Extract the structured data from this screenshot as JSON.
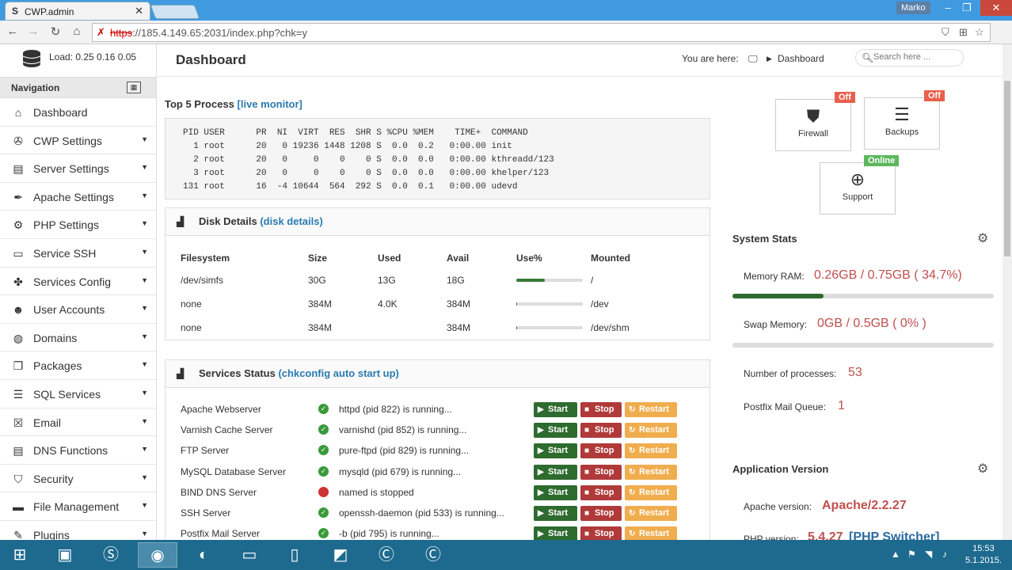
{
  "browser": {
    "tab_title": "CWP.admin",
    "tab_favicon": "S",
    "user_name": "Marko",
    "url_scheme": "https",
    "url_rest": "://185.4.149.65:2031/index.php?chk=y"
  },
  "sidebar": {
    "load_label": "Load: 0.25  0.16  0.05",
    "nav_title": "Navigation",
    "items": [
      {
        "label": "Dashboard",
        "icon": "home-icon",
        "glyph": "⌂",
        "caret": false
      },
      {
        "label": "CWP Settings",
        "icon": "wrench-icon",
        "glyph": "✇",
        "caret": true
      },
      {
        "label": "Server Settings",
        "icon": "server-icon",
        "glyph": "▤",
        "caret": true
      },
      {
        "label": "Apache Settings",
        "icon": "feather-icon",
        "glyph": "✒",
        "caret": true
      },
      {
        "label": "PHP Settings",
        "icon": "gear-icon",
        "glyph": "⚙",
        "caret": true
      },
      {
        "label": "Service SSH",
        "icon": "monitor-icon",
        "glyph": "▭",
        "caret": true
      },
      {
        "label": "Services Config",
        "icon": "puzzle-icon",
        "glyph": "✤",
        "caret": true
      },
      {
        "label": "User Accounts",
        "icon": "user-icon",
        "glyph": "☻",
        "caret": true
      },
      {
        "label": "Domains",
        "icon": "globe-icon",
        "glyph": "◍",
        "caret": true
      },
      {
        "label": "Packages",
        "icon": "package-icon",
        "glyph": "❒",
        "caret": true
      },
      {
        "label": "SQL Services",
        "icon": "database-icon",
        "glyph": "☰",
        "caret": true
      },
      {
        "label": "Email",
        "icon": "email-icon",
        "glyph": "☒",
        "caret": true
      },
      {
        "label": "DNS Functions",
        "icon": "dns-icon",
        "glyph": "▤",
        "caret": true
      },
      {
        "label": "Security",
        "icon": "shield-icon",
        "glyph": "⛉",
        "caret": true
      },
      {
        "label": "File Management",
        "icon": "folder-icon",
        "glyph": "▬",
        "caret": true
      },
      {
        "label": "Plugins",
        "icon": "plugin-icon",
        "glyph": "✎",
        "caret": true
      }
    ]
  },
  "header": {
    "title": "Dashboard",
    "you_are_here": "You are here:",
    "breadcrumb": "Dashboard",
    "search_placeholder": "Search here ..."
  },
  "top_process": {
    "title": "Top 5 Process",
    "link": "[live monitor]",
    "lines": [
      "PID USER      PR  NI  VIRT  RES  SHR S %CPU %MEM    TIME+  COMMAND",
      "  1 root      20   0 19236 1448 1208 S  0.0  0.2   0:00.00 init",
      "  2 root      20   0     0    0    0 S  0.0  0.0   0:00.00 kthreadd/123",
      "  3 root      20   0     0    0    0 S  0.0  0.0   0:00.00 khelper/123",
      "131 root      16  -4 10644  564  292 S  0.0  0.1   0:00.00 udevd"
    ]
  },
  "disk": {
    "title": "Disk Details",
    "link": "(disk details)",
    "headers": [
      "Filesystem",
      "Size",
      "Used",
      "Avail",
      "Use%",
      "Mounted"
    ],
    "rows": [
      {
        "fs": "/dev/simfs",
        "size": "30G",
        "used": "13G",
        "avail": "18G",
        "use_pct": 43,
        "mount": "/"
      },
      {
        "fs": "none",
        "size": "384M",
        "used": "4.0K",
        "avail": "384M",
        "use_pct": 1,
        "mount": "/dev"
      },
      {
        "fs": "none",
        "size": "384M",
        "used": "",
        "avail": "384M",
        "use_pct": 0,
        "mount": "/dev/shm"
      }
    ]
  },
  "services": {
    "title": "Services Status",
    "link": "(chkconfig auto start up)",
    "start_label": "Start",
    "stop_label": "Stop",
    "restart_label": "Restart",
    "rows": [
      {
        "name": "Apache Webserver",
        "status": "httpd (pid 822) is running...",
        "ok": true
      },
      {
        "name": "Varnish Cache Server",
        "status": "varnishd (pid 852) is running...",
        "ok": true
      },
      {
        "name": "FTP Server",
        "status": "pure-ftpd (pid 829) is running...",
        "ok": true
      },
      {
        "name": "MySQL Database Server",
        "status": "mysqld (pid 679) is running...",
        "ok": true
      },
      {
        "name": "BIND DNS Server",
        "status": "named is stopped",
        "ok": false
      },
      {
        "name": "SSH Server",
        "status": "openssh-daemon (pid 533) is running...",
        "ok": true
      },
      {
        "name": "Postfix Mail Server",
        "status": "-b (pid 795) is running...",
        "ok": true
      }
    ]
  },
  "quick": {
    "firewall": {
      "label": "Firewall",
      "badge": "Off"
    },
    "backups": {
      "label": "Backups",
      "badge": "Off"
    },
    "support": {
      "label": "Support",
      "badge": "Online"
    },
    "colors": {
      "off": "#e8604c",
      "online": "#5cb85c"
    }
  },
  "stats": {
    "title": "System Stats",
    "memory_label": "Memory RAM:",
    "memory_value": "0.26GB / 0.75GB ( 34.7%)",
    "memory_pct": 34.7,
    "swap_label": "Swap Memory:",
    "swap_value": "0GB / 0.5GB ( 0% )",
    "swap_pct": 0,
    "processes_label": "Number of processes:",
    "processes_value": "53",
    "queue_label": "Postfix Mail Queue:",
    "queue_value": "1"
  },
  "appver": {
    "title": "Application Version",
    "apache_label": "Apache version:",
    "apache_value": "Apache/2.2.27",
    "php_label": "PHP version:",
    "php_value": "5.4.27",
    "php_link": "[PHP Switcher]"
  },
  "taskbar": {
    "time": "15:53",
    "date": "5.1.2015."
  }
}
